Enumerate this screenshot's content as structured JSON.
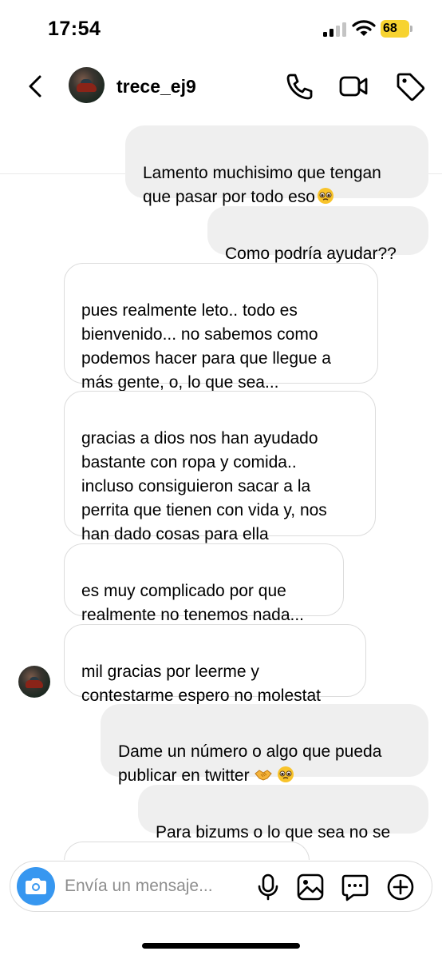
{
  "status_bar": {
    "time": "17:54",
    "battery": "68"
  },
  "header": {
    "username": "trece_ej9"
  },
  "messages": [
    {
      "side": "sent",
      "text": "Lamento muchisimo que tengan\nque pasar por todo eso",
      "emoji": [
        "pleading-face"
      ]
    },
    {
      "side": "sent",
      "text": "Como podría ayudar??"
    },
    {
      "side": "received",
      "text": "pues realmente leto.. todo es\nbienvenido... no sabemos como\npodemos hacer para que llegue a\nmás gente, o, lo que sea..."
    },
    {
      "side": "received",
      "text": "gracias a dios nos han ayudado\nbastante con ropa y comida..\nincluso consiguieron sacar a la\nperrita que tienen con vida y, nos\nhan dado cosas para ella"
    },
    {
      "side": "received",
      "text": "es muy complicado por que\nrealmente no tenemos nada..."
    },
    {
      "side": "received",
      "text": "mil gracias por leerme y\ncontestarme espero no molestat"
    },
    {
      "side": "sent",
      "text": "Dame un número o algo que pueda\npublicar en twitter",
      "emoji": [
        "handshake",
        "pleading-face"
      ]
    },
    {
      "side": "sent",
      "text": "Para bizums o lo que sea no se"
    }
  ],
  "composer": {
    "placeholder": "Envía un mensaje..."
  },
  "icons": {
    "back": "chevron-left-icon",
    "phone": "phone-icon",
    "video": "video-camera-icon",
    "tag": "tag-icon",
    "camera": "camera-icon",
    "mic": "microphone-icon",
    "gallery": "image-icon",
    "sticker": "chat-bubble-icon",
    "add": "plus-circle-icon"
  },
  "colors": {
    "accent": "#3797f0",
    "sent_bubble": "#efefef",
    "battery": "#f7d330"
  }
}
